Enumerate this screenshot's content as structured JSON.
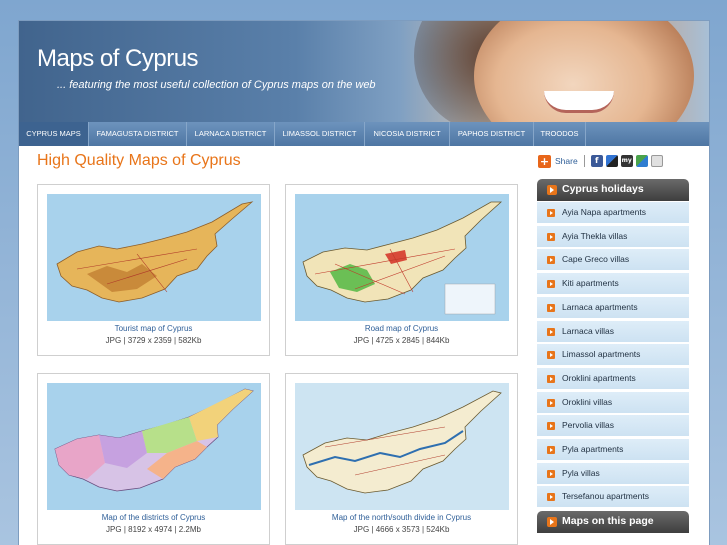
{
  "header": {
    "title": "Maps of Cyprus",
    "tagline": "... featuring the most useful collection of Cyprus maps on the web"
  },
  "nav": {
    "items": [
      {
        "label": "CYPRUS MAPS",
        "active": true
      },
      {
        "label": "FAMAGUSTA DISTRICT",
        "active": false
      },
      {
        "label": "LARNACA DISTRICT",
        "active": false
      },
      {
        "label": "LIMASSOL DISTRICT",
        "active": false
      },
      {
        "label": "NICOSIA DISTRICT",
        "active": false
      },
      {
        "label": "PAPHOS DISTRICT",
        "active": false
      },
      {
        "label": "TROODOS",
        "active": false
      }
    ]
  },
  "main": {
    "heading": "High Quality Maps of Cyprus",
    "maps": [
      {
        "caption": "Tourist map of Cyprus",
        "meta": "JPG | 3729 x 2359 | 582Kb"
      },
      {
        "caption": "Road map of Cyprus",
        "meta": "JPG | 4725 x 2845 | 844Kb"
      },
      {
        "caption": "Map of the districts of Cyprus",
        "meta": "JPG | 8192 x 4974 | 2.2Mb"
      },
      {
        "caption": "Map of the north/south divide in Cyprus",
        "meta": "JPG | 4666 x 3573 | 524Kb"
      }
    ]
  },
  "share": {
    "label": "Share",
    "icons": [
      "facebook-icon",
      "delicious-icon",
      "myspace-icon",
      "google-icon",
      "more-icon"
    ]
  },
  "sidebar": {
    "holidays_title": "Cyprus holidays",
    "holidays": [
      "Ayia Napa apartments",
      "Ayia Thekla villas",
      "Cape Greco villas",
      "Kiti apartments",
      "Larnaca apartments",
      "Larnaca villas",
      "Limassol apartments",
      "Oroklini apartments",
      "Oroklini villas",
      "Pervolia villas",
      "Pyla apartments",
      "Pyla villas",
      "Tersefanou apartments"
    ],
    "maps_title": "Maps on this page"
  },
  "colors": {
    "accent": "#e8751a",
    "nav": "#4e76a3",
    "link": "#2f5f98"
  }
}
